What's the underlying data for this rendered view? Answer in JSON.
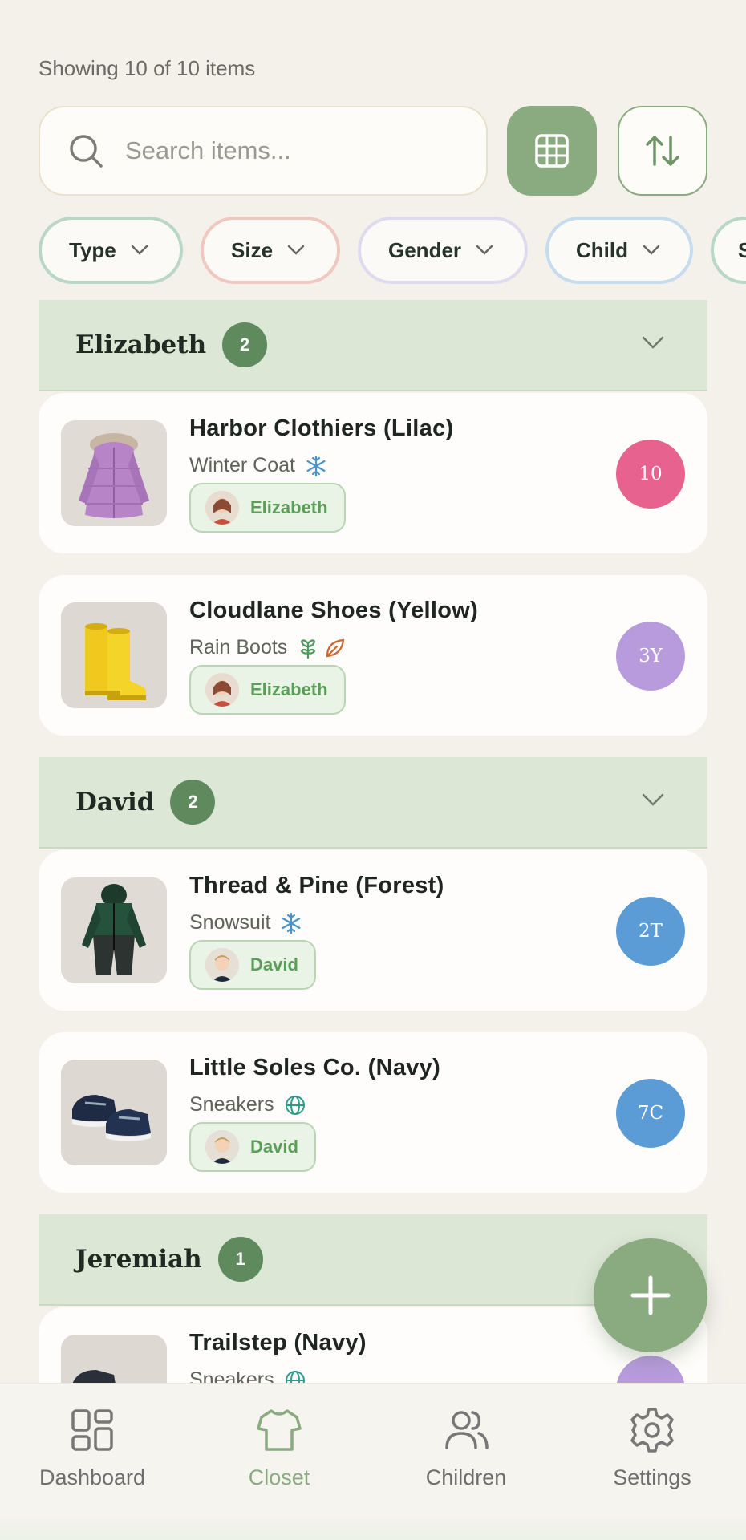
{
  "status": {
    "count_text": "Showing 10 of 10 items"
  },
  "search": {
    "placeholder": "Search items..."
  },
  "filters": [
    {
      "label": "Type"
    },
    {
      "label": "Size"
    },
    {
      "label": "Gender"
    },
    {
      "label": "Child"
    },
    {
      "label": "S"
    }
  ],
  "groups": [
    {
      "name": "Elizabeth",
      "count": "2",
      "items": [
        {
          "title": "Harbor Clothiers (Lilac)",
          "type": "Winter Coat",
          "season_icons": [
            "snowflake-icon"
          ],
          "child": "Elizabeth",
          "size": "10",
          "size_color": "#e7628e"
        },
        {
          "title": "Cloudlane Shoes (Yellow)",
          "type": "Rain Boots",
          "season_icons": [
            "sprout-icon",
            "leaf-icon"
          ],
          "child": "Elizabeth",
          "size": "3Y",
          "size_color": "#b79bdc"
        }
      ]
    },
    {
      "name": "David",
      "count": "2",
      "items": [
        {
          "title": "Thread & Pine (Forest)",
          "type": "Snowsuit",
          "season_icons": [
            "snowflake-icon"
          ],
          "child": "David",
          "size": "2T",
          "size_color": "#5b9bd6"
        },
        {
          "title": "Little Soles Co. (Navy)",
          "type": "Sneakers",
          "season_icons": [
            "globe-icon"
          ],
          "child": "David",
          "size": "7C",
          "size_color": "#5b9bd6"
        }
      ]
    },
    {
      "name": "Jeremiah",
      "count": "1",
      "items": [
        {
          "title": "Trailstep (Navy)",
          "type": "Sneakers",
          "season_icons": [
            "globe-icon"
          ]
        }
      ]
    }
  ],
  "nav": {
    "items": [
      {
        "label": "Dashboard",
        "icon": "dashboard-icon"
      },
      {
        "label": "Closet",
        "icon": "shirt-icon",
        "active": true
      },
      {
        "label": "Children",
        "icon": "people-icon"
      },
      {
        "label": "Settings",
        "icon": "gear-icon"
      }
    ]
  },
  "colors": {
    "accent": "#8aaa80",
    "group_bg": "#dce7d6",
    "count_badge": "#5e8a5e"
  }
}
